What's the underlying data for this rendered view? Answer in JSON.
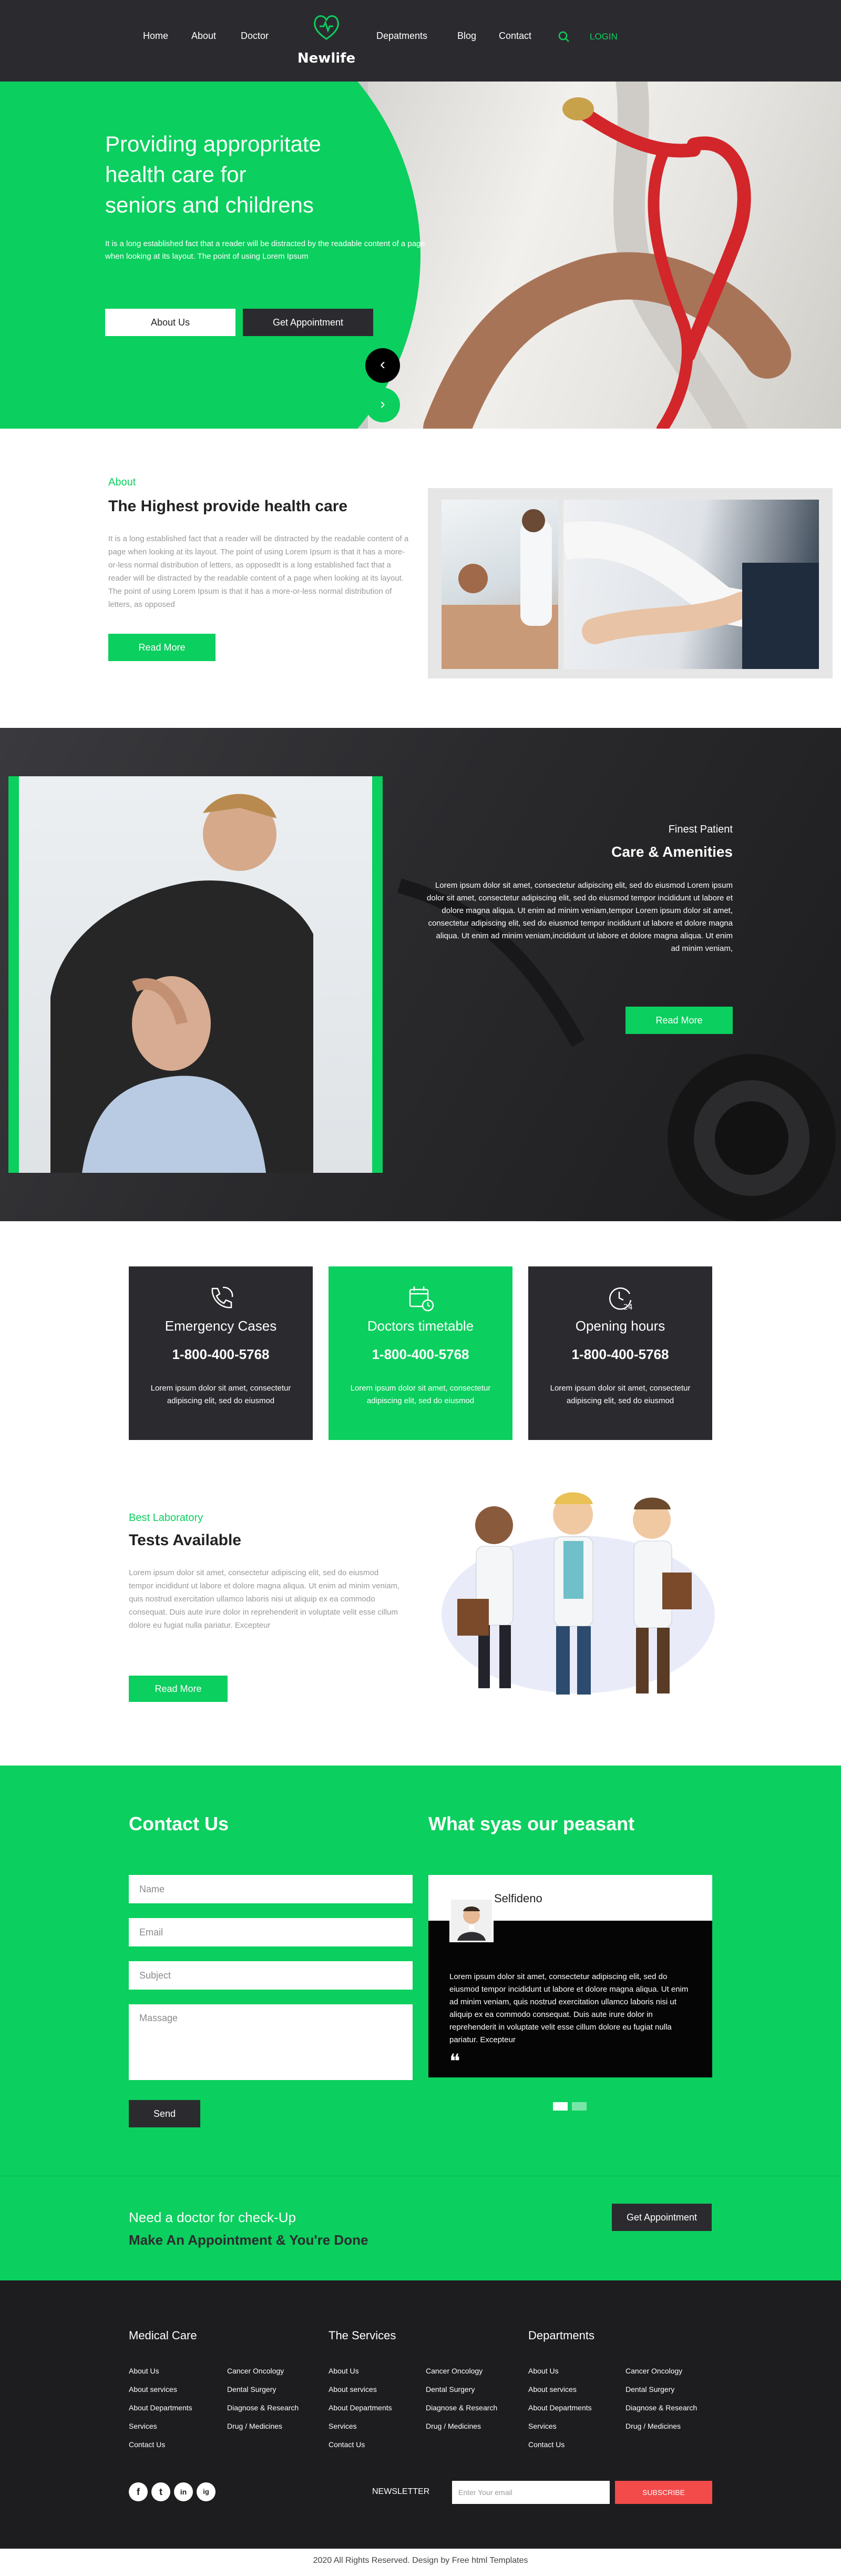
{
  "nav": {
    "left": [
      "Home",
      "About",
      "Doctor"
    ],
    "right": [
      "Depatments",
      "Blog",
      "Contact"
    ],
    "login": "LOGIN",
    "logo": "Newlife",
    "search_icon": "search-icon"
  },
  "hero": {
    "title_lines": [
      "Providing appropritate",
      "health care for",
      "seniors and childrens"
    ],
    "desc": "It is a long established fact that a reader will be distracted by the readable content of a page when looking at its layout. The point of using Lorem Ipsum",
    "btn1": "About Us",
    "btn2": "Get Appointment",
    "prev": "‹",
    "next": "›"
  },
  "about": {
    "tag": "About",
    "title": "The Highest provide health care",
    "text": "It is a long established fact that a reader will be distracted by the readable content of a page when looking at its layout. The point of using Lorem Ipsum is that it has a more-or-less normal distribution of letters, as opposedIt is a long established fact that a reader will be distracted by the readable content of a page when looking at its layout. The point of using Lorem Ipsum is that it has a more-or-less normal distribution of letters, as opposed",
    "btn": "Read More"
  },
  "amenities": {
    "tag": "Finest Patient",
    "title": "Care & Amenities",
    "text": "Lorem ipsum dolor sit amet, consectetur adipiscing elit, sed do eiusmod Lorem ipsum dolor sit amet, consectetur adipiscing elit, sed do eiusmod tempor incididunt ut labore et dolore magna aliqua. Ut enim ad minim veniam,tempor Lorem ipsum dolor sit amet, consectetur adipiscing elit, sed do eiusmod tempor incididunt ut labore et dolore magna aliqua. Ut enim ad minim veniam,incididunt ut labore et dolore magna aliqua. Ut enim ad minim veniam,",
    "btn": "Read More"
  },
  "cards": [
    {
      "title": "Emergency Cases",
      "phone": "1-800-400-5768",
      "desc": "Lorem ipsum dolor sit amet, consectetur adipiscing elit, sed do eiusmod",
      "icon": "phone-icon"
    },
    {
      "title": "Doctors timetable",
      "phone": "1-800-400-5768",
      "desc": "Lorem ipsum dolor sit amet, consectetur adipiscing elit, sed do eiusmod",
      "icon": "calendar-icon"
    },
    {
      "title": "Opening hours",
      "phone": "1-800-400-5768",
      "desc": "Lorem ipsum dolor sit amet, consectetur adipiscing elit, sed do eiusmod",
      "icon": "clock-24-icon"
    }
  ],
  "lab": {
    "tag": "Best Laboratory",
    "title": "Tests Available",
    "text": "Lorem ipsum dolor sit amet, consectetur adipiscing elit, sed do eiusmod tempor incididunt ut labore et dolore magna aliqua. Ut enim ad minim veniam, quis nostrud exercitation ullamco laboris nisi ut aliquip ex ea commodo consequat. Duis aute irure dolor in reprehenderit in voluptate velit esse cillum dolore eu fugiat nulla pariatur. Excepteur",
    "btn": "Read More"
  },
  "contact": {
    "title": "Contact Us",
    "name_ph": "Name",
    "email_ph": "Email",
    "subject_ph": "Subject",
    "message_ph": "Massage",
    "send": "Send"
  },
  "testimonial": {
    "title": "What syas our peasant",
    "name": "Selfideno",
    "text": "Lorem ipsum dolor sit amet, consectetur adipiscing elit, sed do eiusmod tempor incididunt ut labore et dolore magna aliqua. Ut enim ad minim veniam, quis nostrud exercitation ullamco laboris nisi ut aliquip ex ea commodo consequat. Duis aute irure dolor in reprehenderit in voluptate velit esse cillum dolore eu fugiat nulla pariatur. Excepteur",
    "quote": "❝"
  },
  "appointment": {
    "line1": "Need a doctor for check-Up",
    "line2": "Make An Appointment & You're Done",
    "btn": "Get Appointment"
  },
  "footer": {
    "col1_title": "Medical Care",
    "col2_title": "The Services",
    "col3_title": "Departments",
    "links_a": [
      "About Us",
      "About services",
      "About Departments",
      "Services",
      "Contact Us"
    ],
    "links_b": [
      "Cancer Oncology",
      "Dental Surgery",
      "Diagnose & Research",
      "Drug / Medicines"
    ],
    "newsletter": "NEWSLETTER",
    "email_ph": "Enter Your email",
    "subscribe": "SUBSCRIBE",
    "social": [
      "f",
      "t",
      "in",
      "ig"
    ]
  },
  "copyright": "2020 All Rights Reserved. Design by Free html Templates",
  "colors": {
    "green": "#0bcf5e",
    "dark": "#2b2b2f",
    "footer": "#1d1d1f",
    "red": "#f34a4a"
  }
}
